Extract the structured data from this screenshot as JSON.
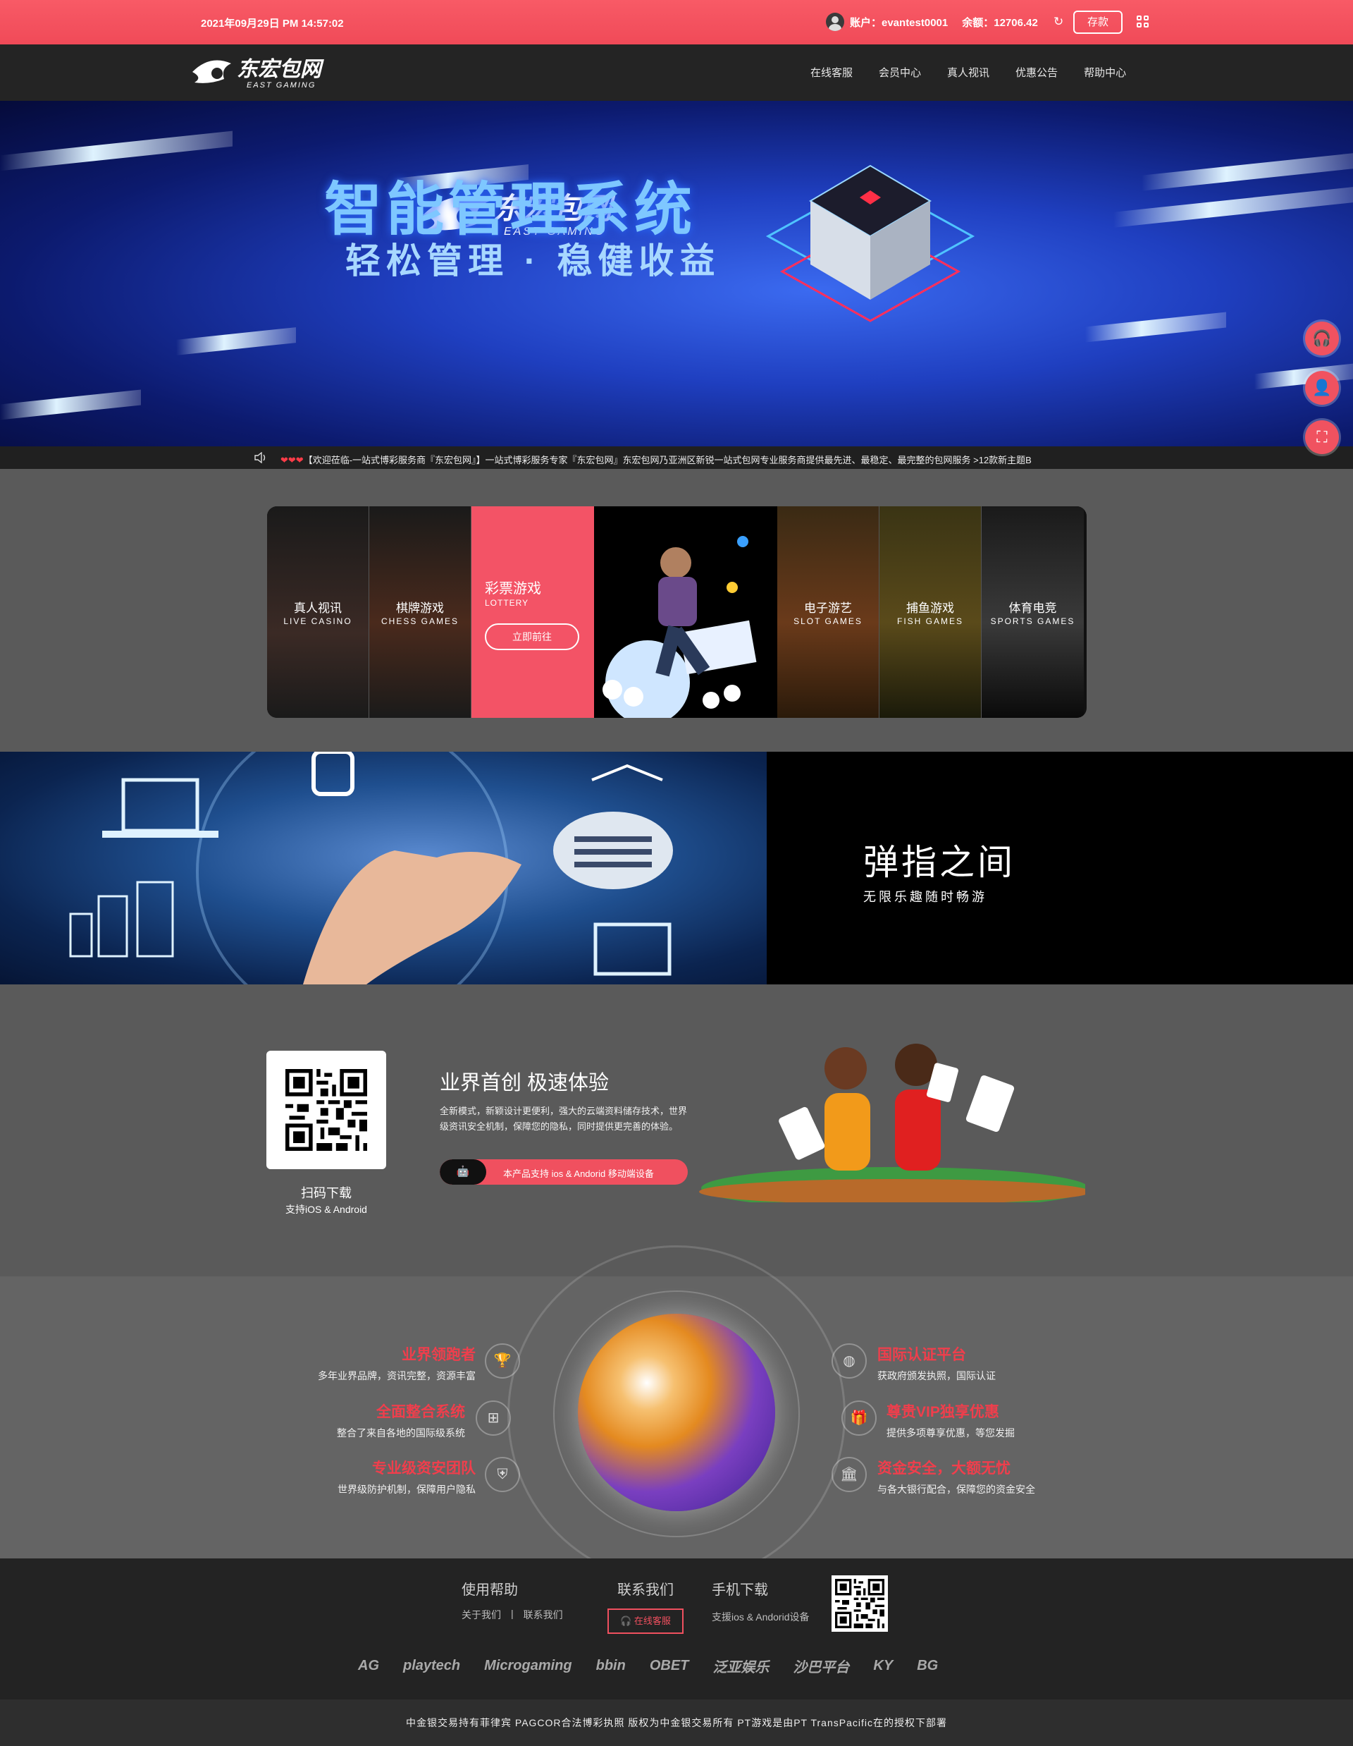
{
  "topbar": {
    "datetime": "2021年09月29日 PM 14:57:02",
    "account_label": "账户：evantest0001",
    "balance_label": "余额：12706.42",
    "deposit": "存款"
  },
  "nav": {
    "items": [
      "在线客服",
      "会员中心",
      "真人视讯",
      "优惠公告",
      "帮助中心"
    ]
  },
  "banner": {
    "logo_cn": "东宏包网",
    "logo_en": "EAST GAMING",
    "title": "智能管理系统",
    "subtitle": "轻松管理 · 稳健收益"
  },
  "marquee": {
    "hearts": "❤❤❤",
    "text": "【欢迎莅临-一站式博彩服务商『东宏包网』】一站式博彩服务专家『东宏包网』东宏包网乃亚洲区新锐一站式包网专业服务商提供最先进、最稳定、最完整的包网服务 >12款新主题B"
  },
  "games": [
    {
      "cn": "真人视讯",
      "en": "LIVE CASINO"
    },
    {
      "cn": "棋牌游戏",
      "en": "CHESS GAMES"
    },
    {
      "cn": "电子游艺",
      "en": "SLOT GAMES"
    },
    {
      "cn": "捕鱼游戏",
      "en": "FISH GAMES"
    },
    {
      "cn": "体育电竞",
      "en": "SPORTS GAMES"
    }
  ],
  "lottery": {
    "cn": "彩票游戏",
    "en": "LOTTERY",
    "button": "立即前往"
  },
  "strip": {
    "title": "弹指之间",
    "subtitle": "无限乐趣随时畅游"
  },
  "download": {
    "scan": "扫码下载",
    "support": "支持iOS & Android",
    "title": "业界首创 极速体验",
    "text": "全新模式，新颖设计更便利，强大的云端资料储存技术，世界级资讯安全机制，保障您的隐私，同时提供更完善的体验。",
    "pill": "本产品支持 ios & Andorid 移动端设备"
  },
  "features": {
    "left": [
      {
        "title": "业界领跑者",
        "desc": "多年业界品牌，资讯完整，资源丰富",
        "icon": "trophy-icon"
      },
      {
        "title": "全面整合系统",
        "desc": "整合了来自各地的国际级系统",
        "icon": "network-icon"
      },
      {
        "title": "专业级资安团队",
        "desc": "世界级防护机制，保障用户隐私",
        "icon": "shield-icon"
      }
    ],
    "right": [
      {
        "title": "国际认证平台",
        "desc": "获政府颁发执照，国际认证",
        "icon": "globe-icon"
      },
      {
        "title": "尊贵VIP独享优惠",
        "desc": "提供多项尊享优惠，等您发掘",
        "icon": "gift-icon"
      },
      {
        "title": "资金安全，大额无忧",
        "desc": "与各大银行配合，保障您的资金安全",
        "icon": "bank-icon"
      }
    ]
  },
  "footer": {
    "help_title": "使用帮助",
    "about": "关于我们",
    "sep": "|",
    "contact": "联系我们",
    "contact_title": "联系我们",
    "cs_button": "在线客服",
    "mobile_title": "手机下载",
    "mobile_text": "支援ios & Andorid设备",
    "partners": [
      "AG",
      "playtech",
      "Microgaming",
      "bbin",
      "OBET",
      "泛亚娱乐",
      "沙巴平台",
      "KY",
      "BG"
    ],
    "copyright": "中金银交易持有菲律宾 PAGCOR合法博彩执照 版权为中金银交易所有 PT游戏是由PT TransPacific在的授权下部署"
  },
  "colors": {
    "accent": "#f04a58",
    "nav_bg": "#242424",
    "footer_bg": "#232323"
  }
}
